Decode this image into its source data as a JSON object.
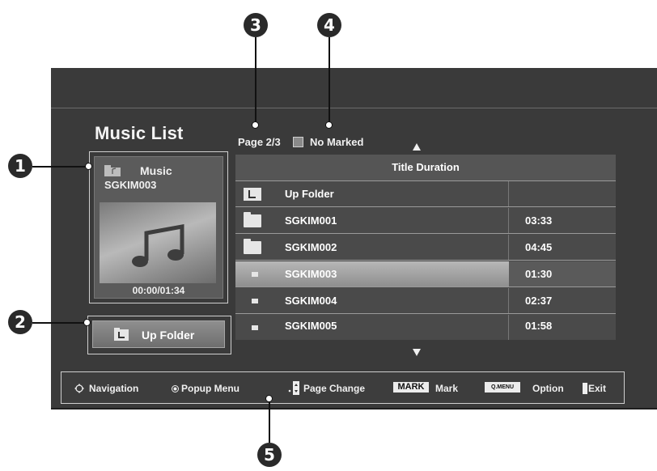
{
  "callouts": [
    "1",
    "2",
    "3",
    "4",
    "5"
  ],
  "title": "Music List",
  "info_panel": {
    "icon": "music-folder-icon",
    "name": "Music",
    "file": "SGKIM003",
    "art_icon": "music-note-icon",
    "time": "00:00/01:34"
  },
  "up_folder_button": {
    "icon": "up-folder-icon",
    "label": "Up Folder"
  },
  "page": {
    "indicator": "Page 2/3",
    "marked": "No Marked"
  },
  "list": {
    "header": "Title Duration",
    "rows": [
      {
        "name": "Up Folder",
        "duration": "",
        "icon": "up-folder-icon"
      },
      {
        "name": "SGKIM001",
        "duration": "03:33",
        "icon": "folder-icon"
      },
      {
        "name": "SGKIM002",
        "duration": "04:45",
        "icon": "folder-icon"
      },
      {
        "name": "SGKIM003",
        "duration": "01:30",
        "icon": "music-file-icon",
        "selected": true
      },
      {
        "name": "SGKIM004",
        "duration": "02:37",
        "icon": "music-file-icon"
      },
      {
        "name": "SGKIM005",
        "duration": "01:58",
        "icon": "music-file-icon"
      }
    ]
  },
  "help_bar": {
    "navigation": "Navigation",
    "popup": "Popup Menu",
    "page_change": "Page Change",
    "mark_key": "MARK",
    "mark": "Mark",
    "qmenu_key": "Q.MENU",
    "option": "Option",
    "exit": "Exit"
  },
  "colors": {
    "screen": "#3a3a3a",
    "selected_row": "#b7b7b7",
    "text": "#f0f0f0"
  }
}
